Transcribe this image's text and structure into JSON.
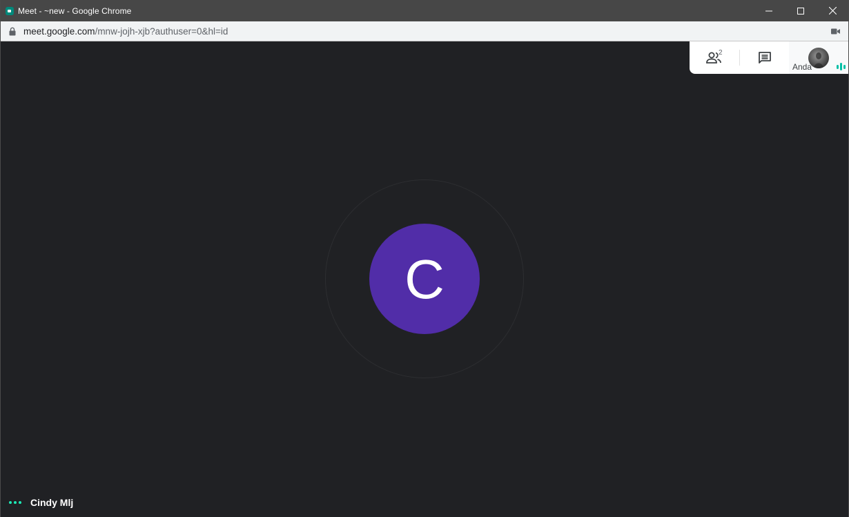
{
  "window": {
    "title": "Meet - ~new - Google Chrome"
  },
  "address_bar": {
    "host": "meet.google.com",
    "path": "/mnw-jojh-xjb?authuser=0&hl=id"
  },
  "top_panel": {
    "participant_count": "2",
    "self_name": "Anda"
  },
  "main_participant": {
    "initial": "C",
    "avatar_color": "#512da8"
  },
  "footer": {
    "participant_name": "Cindy Mlj"
  },
  "colors": {
    "background": "#202124",
    "speaking_indicator": "#00bfa5"
  }
}
